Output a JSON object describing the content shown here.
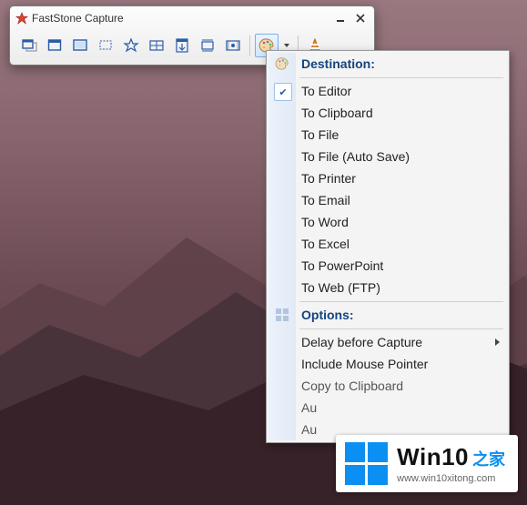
{
  "window": {
    "title": "FastStone Capture"
  },
  "toolbar": {
    "buttons": [
      {
        "name": "capture-active-window-button",
        "icon": "active-window"
      },
      {
        "name": "capture-window-button",
        "icon": "window"
      },
      {
        "name": "capture-fullscreen-button",
        "icon": "fullscreen"
      },
      {
        "name": "capture-rectangle-button",
        "icon": "rect"
      },
      {
        "name": "capture-freehand-button",
        "icon": "freehand"
      },
      {
        "name": "capture-fixed-region-button",
        "icon": "fixed"
      },
      {
        "name": "capture-scrolling-button",
        "icon": "scroll"
      },
      {
        "name": "capture-fixed-size-button",
        "icon": "fixedsize"
      },
      {
        "name": "screen-recorder-button",
        "icon": "video"
      }
    ],
    "output_button": {
      "name": "output-destination-button",
      "icon": "palette"
    },
    "settings_button": {
      "name": "settings-button",
      "icon": "settings-cone"
    }
  },
  "menu": {
    "header1": "Destination:",
    "destinations": [
      {
        "label": "To Editor",
        "checked": true
      },
      {
        "label": "To Clipboard"
      },
      {
        "label": "To File"
      },
      {
        "label": "To File (Auto Save)"
      },
      {
        "label": "To Printer"
      },
      {
        "label": "To Email"
      },
      {
        "label": "To Word"
      },
      {
        "label": "To Excel"
      },
      {
        "label": "To PowerPoint"
      },
      {
        "label": "To Web (FTP)"
      }
    ],
    "header2": "Options:",
    "options": [
      {
        "label": "Delay before Capture",
        "submenu": true
      },
      {
        "label": "Include Mouse Pointer"
      },
      {
        "label": "Copy to Clipboard",
        "truncated": true
      },
      {
        "label": "Au",
        "truncated": true
      },
      {
        "label": "Au",
        "truncated": true
      }
    ]
  },
  "watermark": {
    "name": "Win10",
    "suffix": "之家",
    "url": "www.win10xitong.com"
  }
}
